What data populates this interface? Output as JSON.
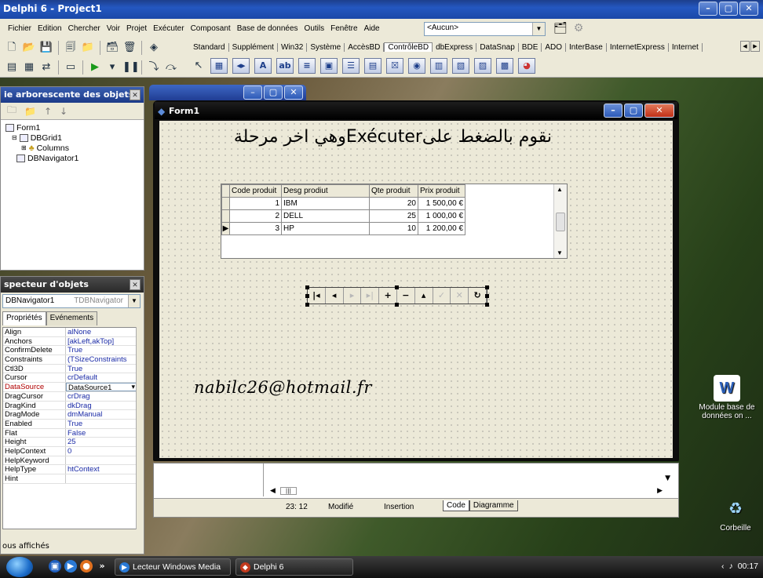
{
  "ide": {
    "title": "Delphi 6 - Project1",
    "menu": [
      "Fichier",
      "Edition",
      "Chercher",
      "Voir",
      "Projet",
      "Exécuter",
      "Composant",
      "Base de données",
      "Outils",
      "Fenêtre",
      "Aide"
    ],
    "desktop_combo": "<Aucun>"
  },
  "palette": {
    "tabs": [
      "Standard",
      "Supplément",
      "Win32",
      "Système",
      "AccèsBD",
      "ContrôleBD",
      "dbExpress",
      "DataSnap",
      "BDE",
      "ADO",
      "InterBase",
      "InternetExpress",
      "Internet"
    ],
    "active_tab": "ContrôleBD"
  },
  "tree_panel": {
    "title": "ie arborescente des objets",
    "nodes": [
      {
        "label": "Form1",
        "indent": 0
      },
      {
        "label": "DBGrid1",
        "indent": 1
      },
      {
        "label": "Columns",
        "indent": 2
      },
      {
        "label": "DBNavigator1",
        "indent": 1
      }
    ]
  },
  "inspector": {
    "title": "specteur d'objets",
    "component_name": "DBNavigator1",
    "component_type": "TDBNavigator",
    "tab_properties": "Propriétés",
    "tab_events": "Evénements",
    "properties": [
      {
        "name": "Align",
        "value": "alNone"
      },
      {
        "name": "Anchors",
        "value": "[akLeft,akTop]"
      },
      {
        "name": "ConfirmDelete",
        "value": "True"
      },
      {
        "name": "Constraints",
        "value": "(TSizeConstraints"
      },
      {
        "name": "Ctl3D",
        "value": "True"
      },
      {
        "name": "Cursor",
        "value": "crDefault"
      },
      {
        "name": "DataSource",
        "value": "DataSource1",
        "highlight": true
      },
      {
        "name": "DragCursor",
        "value": "crDrag"
      },
      {
        "name": "DragKind",
        "value": "dkDrag"
      },
      {
        "name": "DragMode",
        "value": "dmManual"
      },
      {
        "name": "Enabled",
        "value": "True"
      },
      {
        "name": "Flat",
        "value": "False"
      },
      {
        "name": "Height",
        "value": "25"
      },
      {
        "name": "HelpContext",
        "value": "0"
      },
      {
        "name": "HelpKeyword",
        "value": ""
      },
      {
        "name": "HelpType",
        "value": "htContext"
      },
      {
        "name": "Hint",
        "value": ""
      }
    ],
    "status": "ous affichés"
  },
  "form": {
    "title": "Form1",
    "label_arabic": "نقوم بالضغط علىExécuterوهي اخر مرحلة",
    "email_label": "nabilc26@hotmail.fr",
    "grid": {
      "columns": [
        "Code produit",
        "Desg prodiut",
        "Qte  produit",
        "Prix  produit"
      ],
      "rows": [
        {
          "code": "1",
          "desg": "IBM",
          "qte": "20",
          "prix": "1 500,00 €",
          "current": false
        },
        {
          "code": "2",
          "desg": "DELL",
          "qte": "25",
          "prix": "1 000,00 €",
          "current": false
        },
        {
          "code": "3",
          "desg": "HP",
          "qte": "10",
          "prix": "1 200,00 €",
          "current": true
        }
      ]
    },
    "navigator_buttons": [
      {
        "name": "first",
        "glyph": "|◂",
        "enabled": true
      },
      {
        "name": "prior",
        "glyph": "◂",
        "enabled": true
      },
      {
        "name": "next",
        "glyph": "▸",
        "enabled": false
      },
      {
        "name": "last",
        "glyph": "▸|",
        "enabled": false
      },
      {
        "name": "insert",
        "glyph": "+",
        "enabled": true
      },
      {
        "name": "delete",
        "glyph": "−",
        "enabled": true
      },
      {
        "name": "edit",
        "glyph": "▴",
        "enabled": true
      },
      {
        "name": "post",
        "glyph": "✓",
        "enabled": false
      },
      {
        "name": "cancel",
        "glyph": "✕",
        "enabled": false
      },
      {
        "name": "refresh",
        "glyph": "↻",
        "enabled": true
      }
    ]
  },
  "editor": {
    "position": "23: 12",
    "state": "Modifié",
    "mode": "Insertion",
    "tab_code": "Code",
    "tab_diagram": "Diagramme"
  },
  "desktop": {
    "icon1_label": "Module base de données on ...",
    "icon2_label": "Corbeille"
  },
  "taskbar": {
    "btn_media": "Lecteur Windows Media",
    "btn_delphi": "Delphi 6",
    "clock": "00:17"
  }
}
